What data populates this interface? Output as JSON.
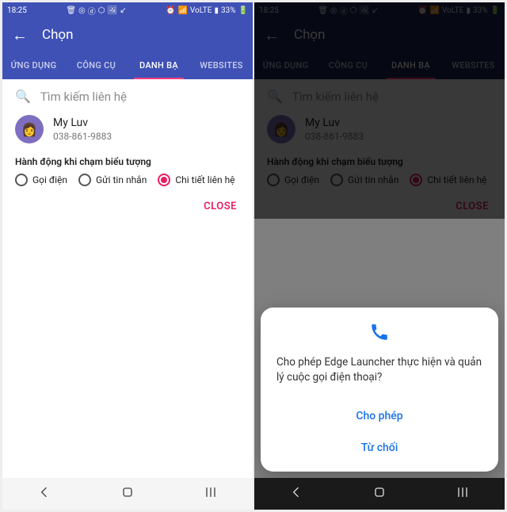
{
  "status": {
    "time": "18:25",
    "battery": "33%",
    "lte": "VoLTE"
  },
  "appbar": {
    "title": "Chọn"
  },
  "tabs": [
    "ỨNG DỤNG",
    "CÔNG CỤ",
    "DANH BẠ",
    "WEBSITES"
  ],
  "active_tab_index": 2,
  "search": {
    "placeholder": "Tìm kiếm liên hệ"
  },
  "contact": {
    "name": "My Luv",
    "phone": "038-861-9883"
  },
  "section_label": "Hành động khi chạm biểu tượng",
  "radio_options": [
    "Gọi điện",
    "Gửi tin nhắn",
    "Chi tiết liên hệ"
  ],
  "selected_radio_index": 2,
  "close_label": "CLOSE",
  "dialog": {
    "text": "Cho phép Edge Launcher thực hiện và quản lý cuộc gọi điện thoại?",
    "allow": "Cho phép",
    "deny": "Từ chối"
  }
}
